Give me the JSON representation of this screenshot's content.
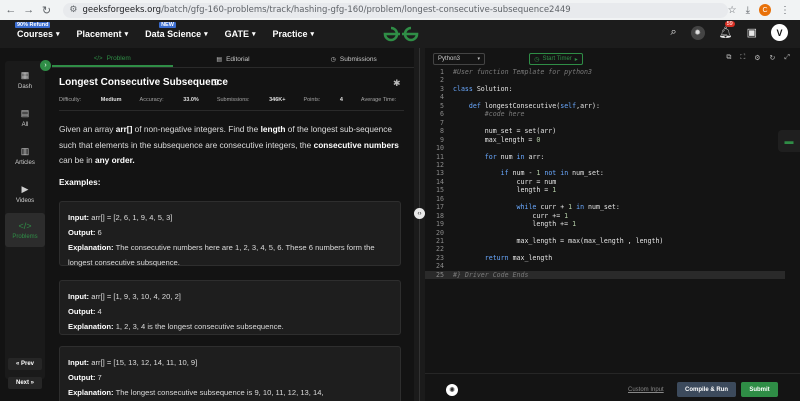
{
  "browser": {
    "url_host": "geeksforgeeks.org",
    "url_path": "/batch/gfg-160-problems/track/hashing-gfg-160/problem/longest-consecutive-subsequence2449",
    "extension_letter": "C"
  },
  "nav": {
    "items": [
      {
        "label": "Courses",
        "badge": "90% Refund"
      },
      {
        "label": "Placement",
        "badge": ""
      },
      {
        "label": "Data Science",
        "badge": "NEW"
      },
      {
        "label": "GATE",
        "badge": ""
      },
      {
        "label": "Practice",
        "badge": ""
      }
    ],
    "logo_text": "GG",
    "notification_count": "59",
    "avatar_letter": "V"
  },
  "sidebar": {
    "items": [
      {
        "label": "Dash",
        "icon": "dashboard-icon"
      },
      {
        "label": "All",
        "icon": "document-icon"
      },
      {
        "label": "Articles",
        "icon": "article-icon"
      },
      {
        "label": "Videos",
        "icon": "video-icon"
      },
      {
        "label": "Problems",
        "icon": "code-icon"
      }
    ],
    "prev": "« Prev",
    "next": "Next »"
  },
  "problem": {
    "tabs": [
      "Problem",
      "Editorial",
      "Submissions"
    ],
    "title": "Longest Consecutive Subsequence",
    "meta": {
      "difficulty_label": "Difficulty:",
      "difficulty": "Medium",
      "accuracy_label": "Accuracy:",
      "accuracy": "33.0%",
      "submissions_label": "Submissions:",
      "submissions": "346K+",
      "points_label": "Points:",
      "points": "4",
      "time_label": "Average Time:",
      "time": "25m"
    },
    "description": [
      {
        "t": "Given an array ",
        "b": false
      },
      {
        "t": "arr[]",
        "b": true
      },
      {
        "t": " of non-negative integers. Find the ",
        "b": false
      },
      {
        "t": "length",
        "b": true
      },
      {
        "t": " of the longest sub-sequence such that elements in the subsequence are consecutive integers, the ",
        "b": false
      },
      {
        "t": "consecutive numbers",
        "b": true
      },
      {
        "t": " can be in ",
        "b": false
      },
      {
        "t": "any order.",
        "b": true
      }
    ],
    "examples_heading": "Examples:",
    "examples": [
      {
        "input": "arr[] = [2, 6, 1, 9, 4, 5, 3]",
        "output": "6",
        "explanation": "The consecutive numbers here are 1, 2, 3, 4, 5, 6. These 6 numbers form the longest consecutive subsquence."
      },
      {
        "input": "arr[] = [1, 9, 3, 10, 4, 20, 2]",
        "output": "4",
        "explanation": "1, 2, 3, 4 is the longest consecutive subsequence."
      },
      {
        "input": "arr[] = [15, 13, 12, 14, 11, 10, 9]",
        "output": "7",
        "explanation": "The longest consecutive subsequence is 9, 10, 11, 12, 13, 14,"
      }
    ],
    "labels": {
      "input": "Input:",
      "output": "Output:",
      "explanation": "Explanation:"
    }
  },
  "editor": {
    "language": "Python3",
    "start_timer": "Start Timer",
    "code_lines": [
      [
        [
          "c",
          "#User function Template for python3"
        ]
      ],
      [],
      [
        [
          "k",
          "class "
        ],
        [
          "f",
          "Solution:"
        ]
      ],
      [],
      [
        [
          "f",
          "    "
        ],
        [
          "k",
          "def "
        ],
        [
          "f",
          "longestConsecutive("
        ],
        [
          "k",
          "self"
        ],
        [
          "f",
          ",arr):"
        ]
      ],
      [
        [
          "f",
          "        "
        ],
        [
          "c",
          "#code here"
        ]
      ],
      [],
      [
        [
          "f",
          "        num_set = set(arr)"
        ]
      ],
      [
        [
          "f",
          "        max_length = "
        ],
        [
          "n",
          "0"
        ]
      ],
      [],
      [
        [
          "f",
          "        "
        ],
        [
          "k",
          "for "
        ],
        [
          "f",
          "num "
        ],
        [
          "k",
          "in "
        ],
        [
          "f",
          "arr:"
        ]
      ],
      [],
      [
        [
          "f",
          "            "
        ],
        [
          "k",
          "if "
        ],
        [
          "f",
          "num - "
        ],
        [
          "n",
          "1 "
        ],
        [
          "k",
          "not in "
        ],
        [
          "f",
          "num_set:"
        ]
      ],
      [
        [
          "f",
          "                curr = num"
        ]
      ],
      [
        [
          "f",
          "                length = "
        ],
        [
          "n",
          "1"
        ]
      ],
      [],
      [
        [
          "f",
          "                "
        ],
        [
          "k",
          "while "
        ],
        [
          "f",
          "curr + "
        ],
        [
          "n",
          "1 "
        ],
        [
          "k",
          "in "
        ],
        [
          "f",
          "num_set:"
        ]
      ],
      [
        [
          "f",
          "                    curr += "
        ],
        [
          "n",
          "1"
        ]
      ],
      [
        [
          "f",
          "                    length += "
        ],
        [
          "n",
          "1"
        ]
      ],
      [],
      [
        [
          "f",
          "                max_length = max(max_length , length)"
        ]
      ],
      [],
      [
        [
          "f",
          "        "
        ],
        [
          "k",
          "return "
        ],
        [
          "f",
          "max_length"
        ]
      ],
      [],
      [
        [
          "c",
          "#} Driver Code Ends"
        ]
      ]
    ],
    "custom_input": "Custom Input",
    "compile_run": "Compile & Run",
    "submit": "Submit"
  }
}
